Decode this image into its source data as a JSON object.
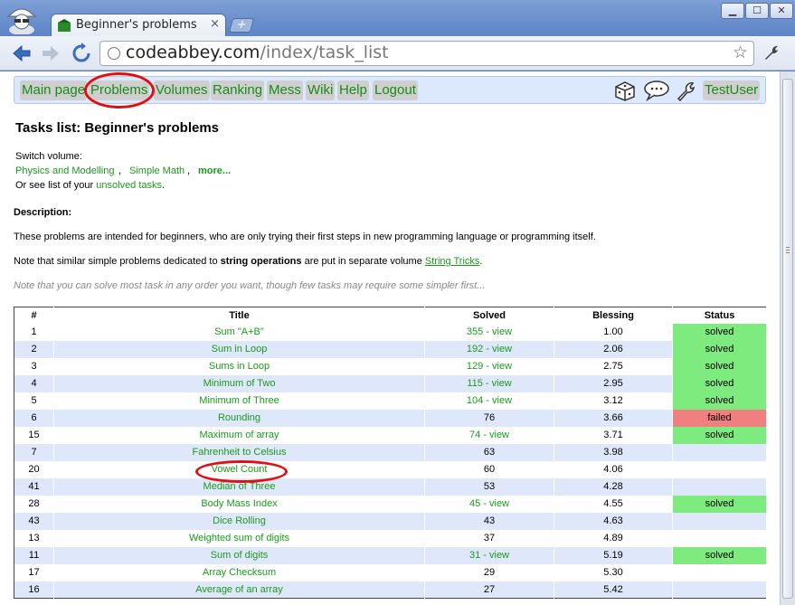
{
  "browser": {
    "tab_title": "Beginner's problems - C",
    "tab_close": "×",
    "new_tab": "+",
    "url_host": "codeabbey.com",
    "url_path": "/index/task_list",
    "star": "☆",
    "wrench": "🔧"
  },
  "menu": {
    "items": [
      "Main page",
      "Problems",
      "Volumes",
      "Ranking",
      "Mess",
      "Wiki",
      "Help",
      "Logout"
    ],
    "user": "TestUser"
  },
  "page": {
    "title": "Tasks list: Beginner's problems",
    "switch_volume": "Switch volume:",
    "volumes": [
      "Physics and Modelling",
      "Simple Math",
      "more..."
    ],
    "unsolved_prefix": "Or see list of your",
    "unsolved_link": "unsolved tasks",
    "unsolved_suffix": ".",
    "description_label": "Description:",
    "description": "These problems are intended for beginners, who are only trying their first steps in new programming language or programming itself.",
    "note_prefix": "Note that similar simple problems dedicated to",
    "note_bold": "string operations",
    "note_middle": "are put in separate volume",
    "note_link": "String Tricks",
    "note_suffix": ".",
    "hint": "Note that you can solve most task in any order you want, though few tasks may require some simpler first..."
  },
  "table": {
    "headers": [
      "#",
      "Title",
      "Solved",
      "Blessing",
      "Status"
    ],
    "rows": [
      {
        "num": "1",
        "title": "Sum \"A+B\"",
        "solved": "355 - view",
        "blessing": "1.00",
        "status": "solved"
      },
      {
        "num": "2",
        "title": "Sum in Loop",
        "solved": "192 - view",
        "blessing": "2.06",
        "status": "solved"
      },
      {
        "num": "3",
        "title": "Sums in Loop",
        "solved": "129 - view",
        "blessing": "2.75",
        "status": "solved"
      },
      {
        "num": "4",
        "title": "Minimum of Two",
        "solved": "115 - view",
        "blessing": "2.95",
        "status": "solved"
      },
      {
        "num": "5",
        "title": "Minimum of Three",
        "solved": "104 - view",
        "blessing": "3.12",
        "status": "solved"
      },
      {
        "num": "6",
        "title": "Rounding",
        "solved": "76",
        "blessing": "3.66",
        "status": "failed"
      },
      {
        "num": "15",
        "title": "Maximum of array",
        "solved": "74 - view",
        "blessing": "3.71",
        "status": "solved"
      },
      {
        "num": "7",
        "title": "Fahrenheit to Celsius",
        "solved": "63",
        "blessing": "3.98",
        "status": ""
      },
      {
        "num": "20",
        "title": "Vowel Count",
        "solved": "60",
        "blessing": "4.06",
        "status": ""
      },
      {
        "num": "41",
        "title": "Median of Three",
        "solved": "53",
        "blessing": "4.28",
        "status": ""
      },
      {
        "num": "28",
        "title": "Body Mass Index",
        "solved": "45 - view",
        "blessing": "4.55",
        "status": "solved"
      },
      {
        "num": "43",
        "title": "Dice Rolling",
        "solved": "43",
        "blessing": "4.63",
        "status": ""
      },
      {
        "num": "13",
        "title": "Weighted sum of digits",
        "solved": "37",
        "blessing": "4.89",
        "status": ""
      },
      {
        "num": "11",
        "title": "Sum of digits",
        "solved": "31 - view",
        "blessing": "5.19",
        "status": "solved"
      },
      {
        "num": "17",
        "title": "Array Checksum",
        "solved": "29",
        "blessing": "5.30",
        "status": ""
      },
      {
        "num": "16",
        "title": "Average of an array",
        "solved": "27",
        "blessing": "5.42",
        "status": ""
      }
    ]
  },
  "colors": {
    "solved": "#7deb7d",
    "failed": "#f08080",
    "link": "#1a9a1a",
    "row_alt": "#dee8fa",
    "annotation": "#e01010"
  },
  "icons": [
    "incognito-icon",
    "codeabbey-favicon",
    "back-icon",
    "forward-icon",
    "reload-icon",
    "globe-icon",
    "star-icon",
    "wrench-icon",
    "dice-icon",
    "chat-icon",
    "settings-icon"
  ]
}
